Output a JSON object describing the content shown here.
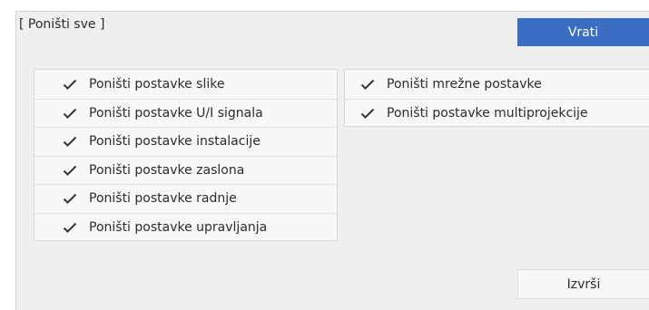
{
  "dialog": {
    "title": "[ Poništi sve ]",
    "back_label": "Vrati",
    "execute_label": "Izvrši"
  },
  "left_items": [
    {
      "label": "Poništi postavke slike",
      "checked": true,
      "icon": "checkmark-icon"
    },
    {
      "label": "Poništi postavke U/I signala",
      "checked": true,
      "icon": "checkmark-icon"
    },
    {
      "label": "Poništi postavke instalacije",
      "checked": true,
      "icon": "checkmark-icon"
    },
    {
      "label": "Poništi postavke zaslona",
      "checked": true,
      "icon": "checkmark-icon"
    },
    {
      "label": "Poništi postavke radnje",
      "checked": true,
      "icon": "checkmark-icon"
    },
    {
      "label": "Poništi postavke upravljanja",
      "checked": true,
      "icon": "checkmark-icon"
    }
  ],
  "right_items": [
    {
      "label": "Poništi mrežne postavke",
      "checked": true,
      "icon": "checkmark-icon"
    },
    {
      "label": "Poništi postavke multiprojekcije",
      "checked": true,
      "icon": "checkmark-icon"
    }
  ],
  "colors": {
    "accent": "#3b6ec2",
    "panel_background": "#efefef",
    "list_background": "#f8f8f8",
    "text": "#2b2b2b"
  }
}
